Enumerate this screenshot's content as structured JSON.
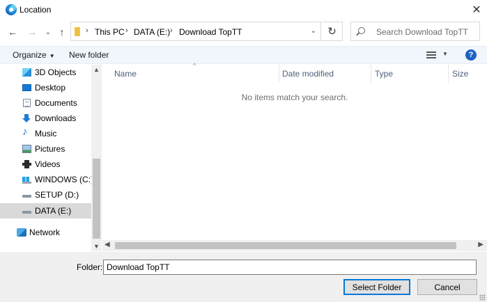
{
  "window": {
    "title": "Location",
    "app_icon": "edge-browser-icon",
    "close_glyph": "✕"
  },
  "nav": {
    "back": "←",
    "forward": "→",
    "recent": "⌄",
    "up": "↑",
    "refresh": "↻"
  },
  "address": {
    "breadcrumbs": [
      "This PC",
      "DATA (E:)",
      "Download TopTT"
    ],
    "separator": "›",
    "dropdown": "⌄"
  },
  "search": {
    "placeholder": "Search Download TopTT"
  },
  "toolbar": {
    "organize": "Organize",
    "new_folder": "New folder",
    "help": "?"
  },
  "sidebar": {
    "items": [
      {
        "label": "3D Objects",
        "icon": "cube-3d-icon"
      },
      {
        "label": "Desktop",
        "icon": "desktop-icon"
      },
      {
        "label": "Documents",
        "icon": "documents-icon"
      },
      {
        "label": "Downloads",
        "icon": "downloads-arrow-icon"
      },
      {
        "label": "Music",
        "icon": "music-note-icon"
      },
      {
        "label": "Pictures",
        "icon": "pictures-icon"
      },
      {
        "label": "Videos",
        "icon": "film-strip-icon"
      },
      {
        "label": "WINDOWS (C:)",
        "icon": "windows-drive-icon"
      },
      {
        "label": "SETUP (D:)",
        "icon": "drive-icon"
      },
      {
        "label": "DATA (E:)",
        "icon": "drive-icon",
        "selected": true
      },
      {
        "label": "Network",
        "icon": "network-icon"
      }
    ]
  },
  "list": {
    "columns": [
      "Name",
      "Date modified",
      "Type",
      "Size"
    ],
    "empty_message": "No items match your search."
  },
  "footer": {
    "folder_label": "Folder:",
    "folder_value": "Download TopTT",
    "select_button": "Select Folder",
    "cancel_button": "Cancel"
  },
  "colors": {
    "accent": "#0078d7",
    "help": "#1d63c4",
    "selected_row": "#d9d9d9",
    "toolbar_bg": "#f0f6fc"
  }
}
